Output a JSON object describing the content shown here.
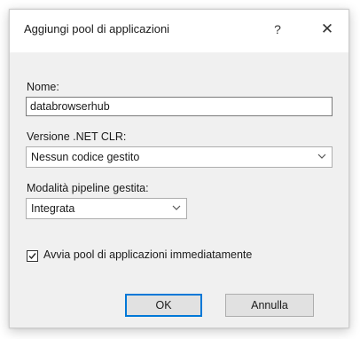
{
  "dialog": {
    "title": "Aggiungi pool di applicazioni",
    "help_label": "?",
    "close_label": "✕"
  },
  "name_field": {
    "label": "Nome:",
    "value": "databrowserhub"
  },
  "clr_version": {
    "label": "Versione .NET CLR:",
    "selected": "Nessun codice gestito",
    "icon": "chevron-down-icon"
  },
  "pipeline_mode": {
    "label": "Modalità pipeline gestita:",
    "selected": "Integrata",
    "icon": "chevron-down-icon"
  },
  "start_immediately": {
    "label": "Avvia pool di applicazioni immediatamente",
    "checked": true,
    "icon": "checkmark-icon"
  },
  "buttons": {
    "ok_label": "OK",
    "cancel_label": "Annulla"
  },
  "colors": {
    "accent": "#0078d7",
    "content_bg": "#f0f0f0"
  }
}
